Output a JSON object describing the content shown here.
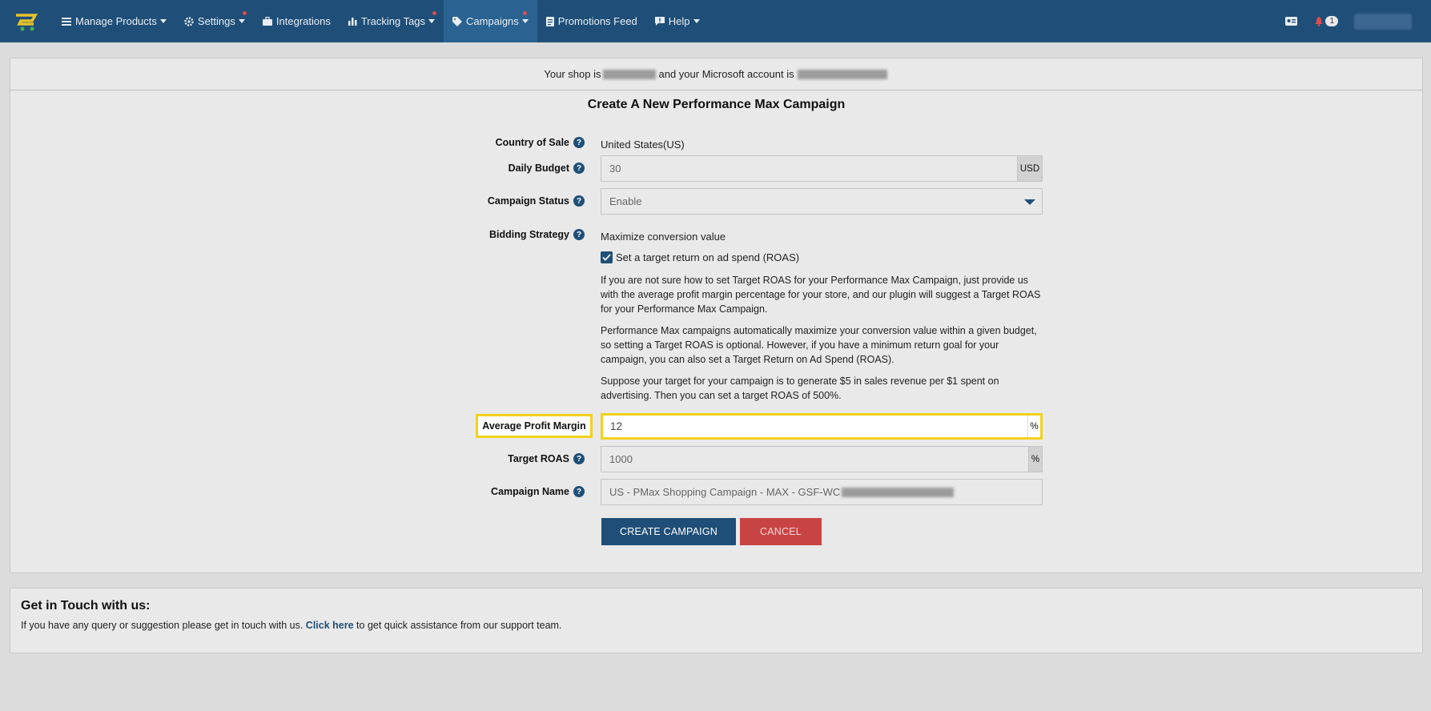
{
  "navbar": {
    "items": [
      {
        "label": "Manage Products",
        "icon": "list-icon",
        "caret": true,
        "dot": false
      },
      {
        "label": "Settings",
        "icon": "gear-icon",
        "caret": true,
        "dot": true
      },
      {
        "label": "Integrations",
        "icon": "briefcase-icon",
        "caret": false,
        "dot": false
      },
      {
        "label": "Tracking Tags",
        "icon": "bar-chart-icon",
        "caret": true,
        "dot": true
      },
      {
        "label": "Campaigns",
        "icon": "tag-icon",
        "caret": true,
        "dot": true,
        "active": true
      },
      {
        "label": "Promotions Feed",
        "icon": "document-icon",
        "caret": false,
        "dot": false
      },
      {
        "label": "Help",
        "icon": "comment-icon",
        "caret": true,
        "dot": false
      }
    ],
    "notification_count": "1"
  },
  "header": {
    "shop_prefix": "Your shop is",
    "account_middle": "and your Microsoft account is"
  },
  "form": {
    "title": "Create A New Performance Max Campaign",
    "country": {
      "label": "Country of Sale",
      "value": "United States(US)"
    },
    "budget": {
      "label": "Daily Budget",
      "value": "30",
      "unit": "USD"
    },
    "status": {
      "label": "Campaign Status",
      "value": "Enable"
    },
    "bidding": {
      "label": "Bidding Strategy",
      "value": "Maximize conversion value",
      "checkbox_label": "Set a target return on ad spend (ROAS)",
      "checked": true,
      "para1": "If you are not sure how to set Target ROAS for your Performance Max Campaign, just provide us with the average profit margin percentage for your store, and our plugin will suggest a Target ROAS for your Performance Max Campaign.",
      "para2": "Performance Max campaigns automatically maximize your conversion value within a given budget, so setting a Target ROAS is optional. However, if you have a minimum return goal for your campaign, you can also set a Target Return on Ad Spend (ROAS).",
      "para3": "Suppose your target for your campaign is to generate $5 in sales revenue per $1 spent on advertising. Then you can set a target ROAS of 500%."
    },
    "margin": {
      "label": "Average Profit Margin",
      "value": "12",
      "unit": "%"
    },
    "roas": {
      "label": "Target ROAS",
      "value": "1000",
      "unit": "%"
    },
    "name": {
      "label": "Campaign Name",
      "value": "US - PMax Shopping Campaign - MAX - GSF-WC"
    },
    "create_label": "CREATE CAMPAIGN",
    "cancel_label": "CANCEL"
  },
  "contact": {
    "title": "Get in Touch with us:",
    "text_before": "If you have any query or suggestion please get in touch with us.",
    "link": "Click here",
    "text_after": "to get quick assistance from our support team."
  },
  "colors": {
    "navbar": "#1f4f78",
    "highlight": "#f2d21c",
    "cancel": "#c84444"
  }
}
